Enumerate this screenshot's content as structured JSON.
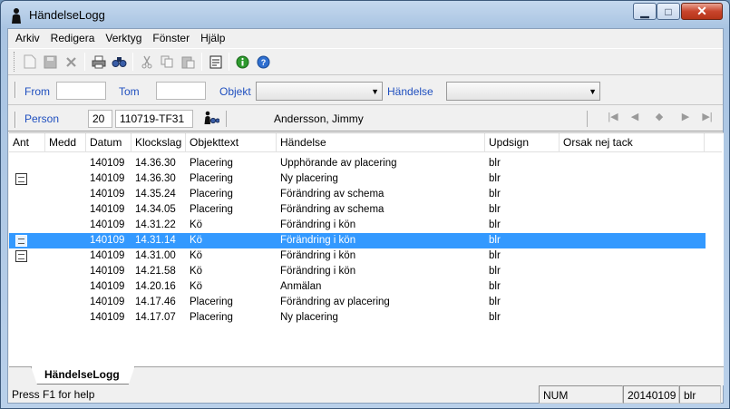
{
  "window": {
    "title": "HändelseLogg"
  },
  "menu": [
    "Arkiv",
    "Redigera",
    "Verktyg",
    "Fönster",
    "Hjälp"
  ],
  "toolbar": {
    "icons": [
      "new-icon",
      "save-icon",
      "delete-icon",
      "print-icon",
      "find-icon",
      "cut-icon",
      "copy-icon",
      "paste-icon",
      "note-icon",
      "info-icon",
      "help-icon"
    ]
  },
  "filters": {
    "from_label": "From",
    "from_value": "",
    "tom_label": "Tom",
    "tom_value": "",
    "objekt_label": "Objekt",
    "objekt_value": "",
    "handelse_label": "Händelse",
    "handelse_value": ""
  },
  "person": {
    "label": "Person",
    "id_prefix": "20",
    "id": "110719-TF31",
    "name": "Andersson, Jimmy"
  },
  "table": {
    "columns": [
      "Ant",
      "Medd",
      "Datum",
      "Klockslag",
      "Objekttext",
      "Händelse",
      "Updsign",
      "Orsak nej tack"
    ],
    "rows": [
      {
        "ant": false,
        "datum": "140109",
        "klockslag": "14.36.30",
        "objekttext": "Placering",
        "handelse": "Upphörande av placering",
        "updsign": "blr",
        "selected": false
      },
      {
        "ant": true,
        "datum": "140109",
        "klockslag": "14.36.30",
        "objekttext": "Placering",
        "handelse": "Ny placering",
        "updsign": "blr",
        "selected": false
      },
      {
        "ant": false,
        "datum": "140109",
        "klockslag": "14.35.24",
        "objekttext": "Placering",
        "handelse": "Förändring av schema",
        "updsign": "blr",
        "selected": false
      },
      {
        "ant": false,
        "datum": "140109",
        "klockslag": "14.34.05",
        "objekttext": "Placering",
        "handelse": "Förändring av schema",
        "updsign": "blr",
        "selected": false
      },
      {
        "ant": false,
        "datum": "140109",
        "klockslag": "14.31.22",
        "objekttext": "Kö",
        "handelse": "Förändring i kön",
        "updsign": "blr",
        "selected": false
      },
      {
        "ant": true,
        "datum": "140109",
        "klockslag": "14.31.14",
        "objekttext": "Kö",
        "handelse": "Förändring i kön",
        "updsign": "blr",
        "selected": true
      },
      {
        "ant": true,
        "datum": "140109",
        "klockslag": "14.31.00",
        "objekttext": "Kö",
        "handelse": "Förändring i kön",
        "updsign": "blr",
        "selected": false
      },
      {
        "ant": false,
        "datum": "140109",
        "klockslag": "14.21.58",
        "objekttext": "Kö",
        "handelse": "Förändring i kön",
        "updsign": "blr",
        "selected": false
      },
      {
        "ant": false,
        "datum": "140109",
        "klockslag": "14.20.16",
        "objekttext": "Kö",
        "handelse": "Anmälan",
        "updsign": "blr",
        "selected": false
      },
      {
        "ant": false,
        "datum": "140109",
        "klockslag": "14.17.46",
        "objekttext": "Placering",
        "handelse": "Förändring av placering",
        "updsign": "blr",
        "selected": false
      },
      {
        "ant": false,
        "datum": "140109",
        "klockslag": "14.17.07",
        "objekttext": "Placering",
        "handelse": "Ny placering",
        "updsign": "blr",
        "selected": false
      }
    ]
  },
  "tab": {
    "label": "HändelseLogg"
  },
  "status": {
    "help": "Press F1 for help",
    "num": "NUM",
    "date": "20140109",
    "user": "blr"
  },
  "colors": {
    "selection": "#3399ff",
    "label_blue": "#1f4fbf"
  }
}
